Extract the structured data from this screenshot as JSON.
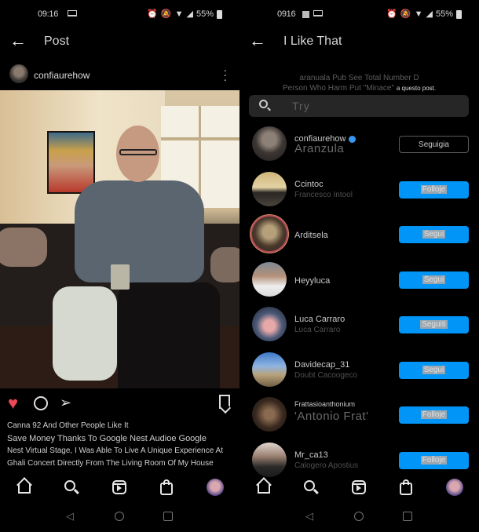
{
  "left": {
    "status": {
      "time": "09:16",
      "battery": "55%"
    },
    "header": {
      "back_icon": "arrow-left-icon",
      "title": "Post"
    },
    "post": {
      "username": "confiaurehow",
      "more_icon": "more-vertical-icon",
      "image_alt": "Man seated on sofa next to a Google Nest Audio speaker",
      "liked": true,
      "likes_text": "Canna 92 And Other People Like It",
      "caption_lines": [
        "Save Money Thanks To Google Nest Audioe Google",
        "Nest Virtual Stage, I Was Able To Live A Unique Experience At",
        "Ghali Concert Directly From The Living Room Of My House"
      ]
    }
  },
  "right": {
    "status": {
      "time": "0916",
      "battery": "55%"
    },
    "header": {
      "back_icon": "arrow-left-icon",
      "title": "I Like That"
    },
    "info_line1": "aranuala Pub See Total Number D",
    "info_line2": "Person Who Harm Put \"Minace\"",
    "info_line2_suffix": "a questo post.",
    "search": {
      "placeholder": "Try",
      "value": ""
    },
    "likers": [
      {
        "username": "confiaurehow",
        "fullname": "Aranzula",
        "verified": true,
        "button": "Seguigia",
        "button_style": "outline"
      },
      {
        "username": "Ccintoc",
        "fullname": "Francesco Intool",
        "button": "Folloje"
      },
      {
        "username": "Arditsela",
        "fullname": "",
        "button": "Segui",
        "story": true
      },
      {
        "username": "Heyyluca",
        "fullname": "",
        "button": "Segui"
      },
      {
        "username": "Luca Carraro",
        "fullname": "Luca Carraro",
        "button": "Seguiti"
      },
      {
        "username": "Davidecap_31",
        "fullname": "Doubt Cacoogeco",
        "button": "Segui"
      },
      {
        "username": "Frattasioanthonium",
        "fullname": "'Antonio Frat'",
        "button": "Folloje"
      },
      {
        "username": "Mr_ca13",
        "fullname": "Calogero Apostius",
        "button": "Folloje"
      }
    ]
  },
  "bottom_nav": {
    "items": [
      "home-icon",
      "search-icon",
      "reels-icon",
      "shop-icon",
      "profile-avatar"
    ]
  },
  "system_nav": {
    "items": [
      "back-icon",
      "home-circle-icon",
      "recents-icon"
    ]
  },
  "colors": {
    "accent": "#0095f6",
    "like": "#ed4956",
    "verified": "#3897f0",
    "background": "#000000"
  }
}
